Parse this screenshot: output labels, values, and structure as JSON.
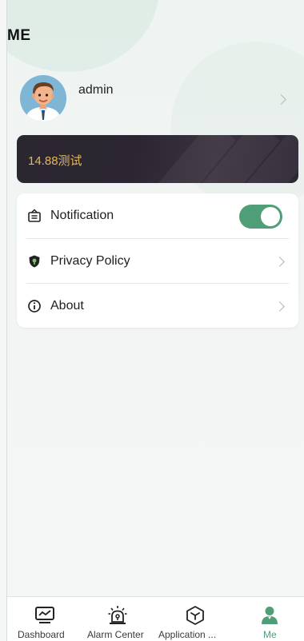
{
  "page": {
    "title": "ME"
  },
  "profile": {
    "username": "admin",
    "avatar": "user-avatar-illustration"
  },
  "banner": {
    "text": "14.88测试",
    "text_color": "#e6b75a",
    "background": "#2b2731"
  },
  "settings": {
    "items": [
      {
        "label": "Notification",
        "icon": "notification-board-icon",
        "control": "toggle",
        "enabled": true
      },
      {
        "label": "Privacy Policy",
        "icon": "shield-icon",
        "control": "chevron"
      },
      {
        "label": "About",
        "icon": "info-icon",
        "control": "chevron"
      }
    ]
  },
  "tabbar": {
    "tabs": [
      {
        "label": "Dashboard",
        "icon": "monitor-chart-icon",
        "active": false
      },
      {
        "label": "Alarm Center",
        "icon": "alarm-siren-icon",
        "active": false
      },
      {
        "label": "Application ...",
        "icon": "cube-icon",
        "active": false
      },
      {
        "label": "Me",
        "icon": "person-icon",
        "active": true
      }
    ]
  },
  "colors": {
    "accent": "#4f9e78",
    "page_background": "#f4f6f6"
  }
}
